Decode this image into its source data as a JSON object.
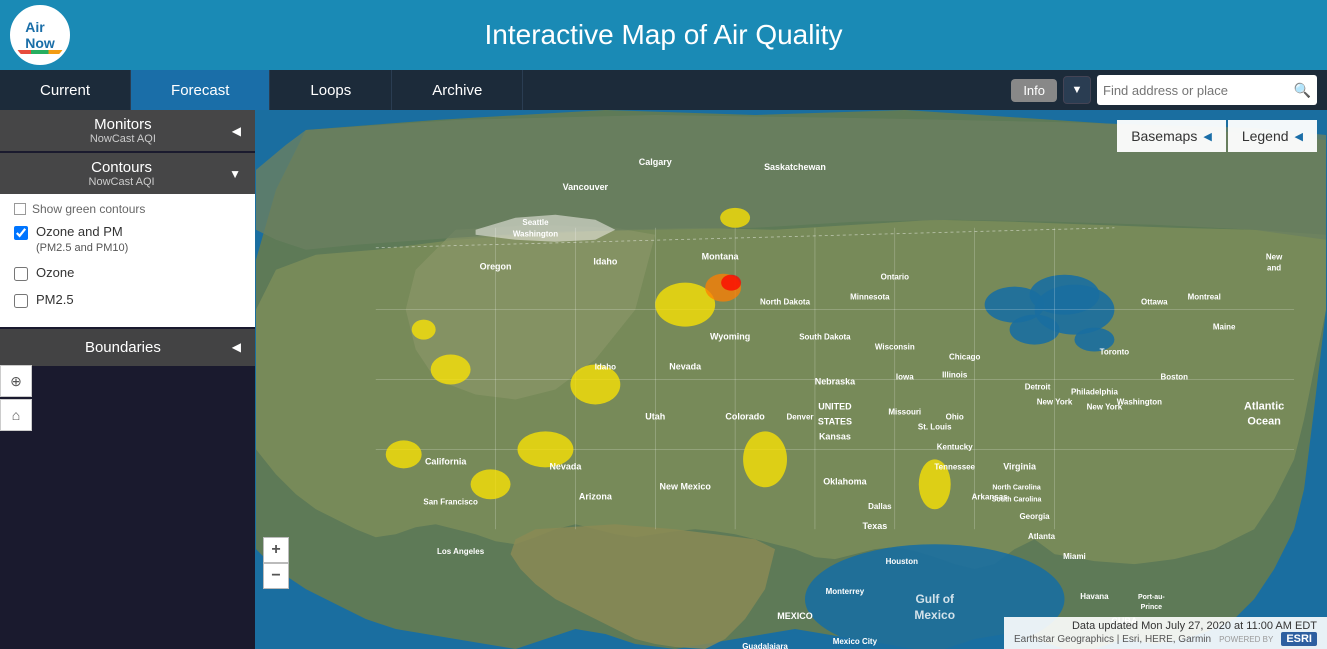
{
  "app": {
    "logo_text": "AirNow",
    "title": "Interactive Map of Air Quality"
  },
  "navbar": {
    "tabs": [
      {
        "id": "current",
        "label": "Current",
        "active": true
      },
      {
        "id": "forecast",
        "label": "Forecast",
        "active": false
      },
      {
        "id": "loops",
        "label": "Loops",
        "active": false
      },
      {
        "id": "archive",
        "label": "Archive",
        "active": false
      }
    ],
    "info_label": "Info",
    "search_placeholder": "Find address or place"
  },
  "left_panel": {
    "monitors": {
      "title": "Monitors",
      "subtitle": "NowCast AQI"
    },
    "contours": {
      "title": "Contours",
      "subtitle": "NowCast AQI",
      "show_green_label": "Show green contours",
      "options": [
        {
          "id": "ozone_pm",
          "label": "Ozone and PM",
          "sublabel": "(PM2.5 and PM10)",
          "checked": true
        },
        {
          "id": "ozone",
          "label": "Ozone",
          "checked": false
        },
        {
          "id": "pm25",
          "label": "PM2.5",
          "checked": false
        }
      ]
    },
    "boundaries": {
      "title": "Boundaries"
    }
  },
  "map": {
    "basemaps_label": "Basemaps",
    "legend_label": "Legend",
    "status_text": "Data updated Mon July 27, 2020 at 11:00 AM EDT",
    "attribution": "Earthstar Geographics | Esri, HERE, Garmin",
    "esri_powered": "POWERED BY",
    "esri_logo": "ESRI"
  },
  "tools": {
    "gps_icon": "⊕",
    "home_icon": "⌂",
    "zoom_in": "+",
    "zoom_out": "−"
  }
}
